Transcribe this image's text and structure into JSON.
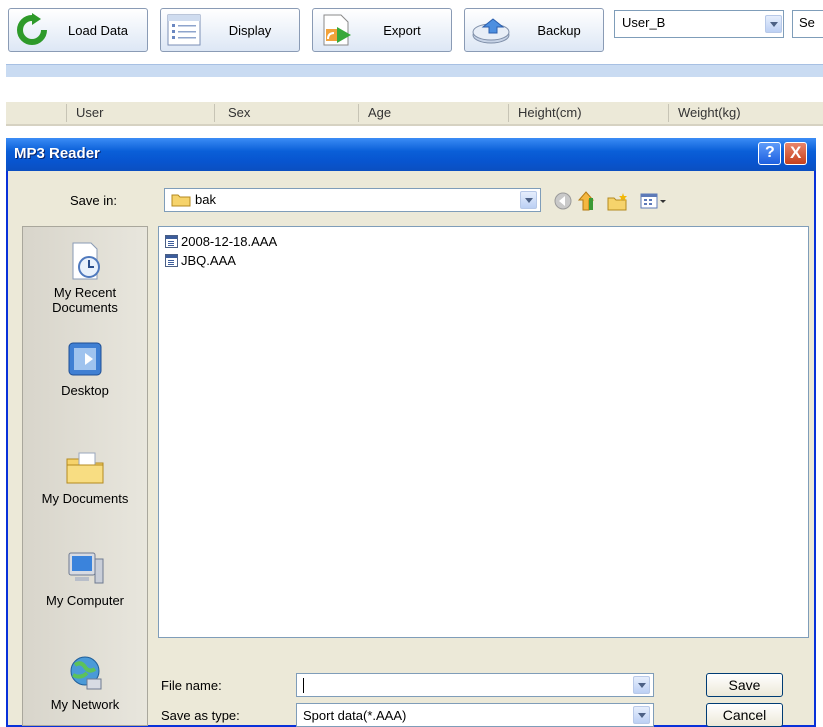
{
  "toolbar": {
    "load_data_label": "Load Data",
    "display_label": "Display",
    "export_label": "Export",
    "backup_label": "Backup",
    "user_select_value": "User_B",
    "second_select_value": "Se"
  },
  "table": {
    "columns": [
      "User",
      "Sex",
      "Age",
      "Height(cm)",
      "Weight(kg)"
    ]
  },
  "dialog": {
    "title": "MP3 Reader",
    "help_label": "?",
    "close_label": "X",
    "save_in_label": "Save in:",
    "save_in_value": "bak",
    "places": [
      {
        "label_1": "My Recent",
        "label_2": "Documents",
        "icon": "recent-documents-icon"
      },
      {
        "label_1": "Desktop",
        "icon": "desktop-icon"
      },
      {
        "label_1": "My Documents",
        "icon": "my-documents-icon"
      },
      {
        "label_1": "My Computer",
        "icon": "my-computer-icon"
      },
      {
        "label_1": "My Network",
        "icon": "my-network-icon"
      }
    ],
    "files": [
      "2008-12-18.AAA",
      "JBQ.AAA"
    ],
    "file_name_label": "File name:",
    "file_name_value": "",
    "save_as_type_label": "Save as type:",
    "save_as_type_value": "Sport data(*.AAA)",
    "save_button": "Save",
    "cancel_button": "Cancel"
  },
  "colors": {
    "title_bar": "#0a5fd8",
    "dialog_bg": "#ece9d8",
    "close_button": "#c6401c"
  }
}
